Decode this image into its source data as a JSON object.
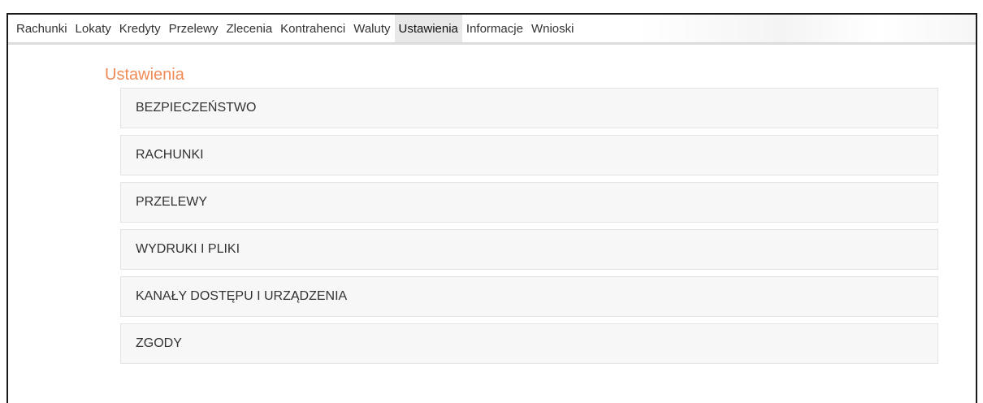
{
  "nav": {
    "items": [
      {
        "label": "Rachunki"
      },
      {
        "label": "Lokaty"
      },
      {
        "label": "Kredyty"
      },
      {
        "label": "Przelewy"
      },
      {
        "label": "Zlecenia"
      },
      {
        "label": "Kontrahenci"
      },
      {
        "label": "Waluty"
      },
      {
        "label": "Ustawienia",
        "active": true
      },
      {
        "label": "Informacje"
      },
      {
        "label": "Wnioski"
      }
    ]
  },
  "page": {
    "title": "Ustawienia"
  },
  "settings": {
    "items": [
      {
        "label": "BEZPIECZEŃSTWO"
      },
      {
        "label": "RACHUNKI"
      },
      {
        "label": "PRZELEWY"
      },
      {
        "label": "WYDRUKI I PLIKI"
      },
      {
        "label": "KANAŁY DOSTĘPU I URZĄDZENIA"
      },
      {
        "label": "ZGODY"
      }
    ]
  },
  "colors": {
    "title_accent": "#f08a57",
    "active_tab_bg": "#e8e8e8",
    "panel_bg": "#f7f7f7"
  }
}
